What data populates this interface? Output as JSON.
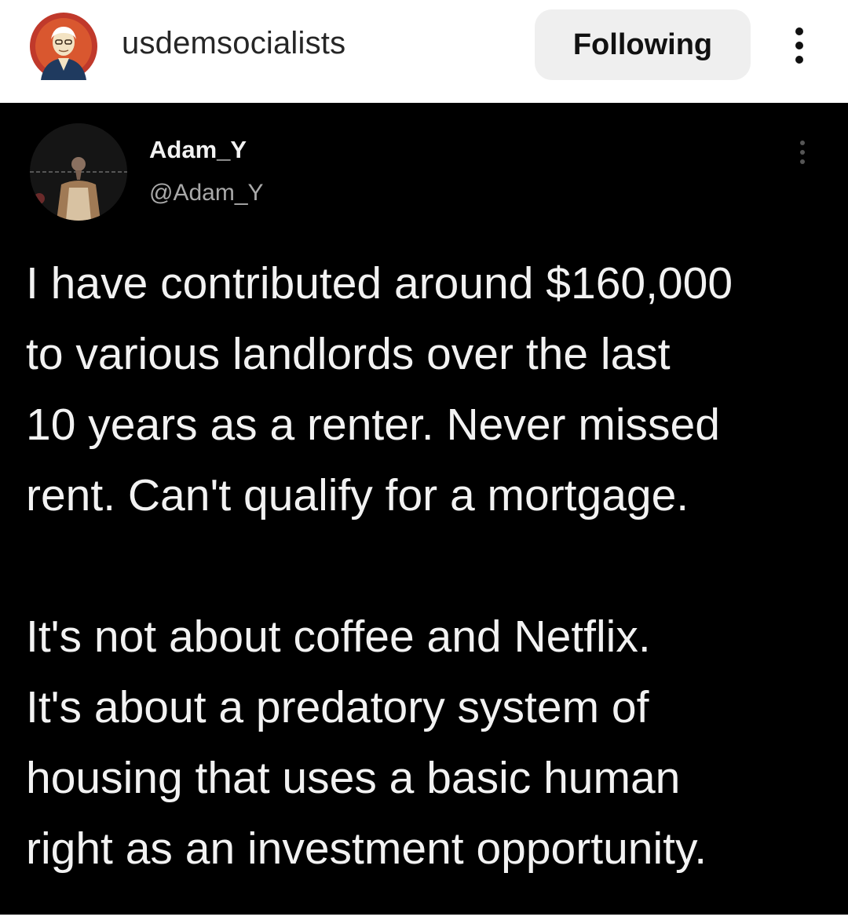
{
  "header": {
    "username": "usdemsocialists",
    "follow_label": "Following",
    "avatar_icon": "profile-avatar-icon",
    "more_icon": "more-vertical-icon"
  },
  "tweet": {
    "display_name": "Adam_Y",
    "handle": "@Adam_Y",
    "more_icon": "more-vertical-icon",
    "lines": [
      "I have contributed around $160,000",
      "to various landlords over the last",
      "10 years as a renter. Never missed",
      "rent. Can't qualify for a mortgage.",
      "It's not about coffee and Netflix.",
      "It's about a predatory system of",
      "housing that uses a basic human",
      "right as an investment opportunity."
    ]
  },
  "colors": {
    "post_background": "#000000",
    "tweet_text": "#f2f2f2",
    "handle_text": "#a9a9a9",
    "button_background": "#efefef",
    "avatar_ring": "#c0392b"
  }
}
